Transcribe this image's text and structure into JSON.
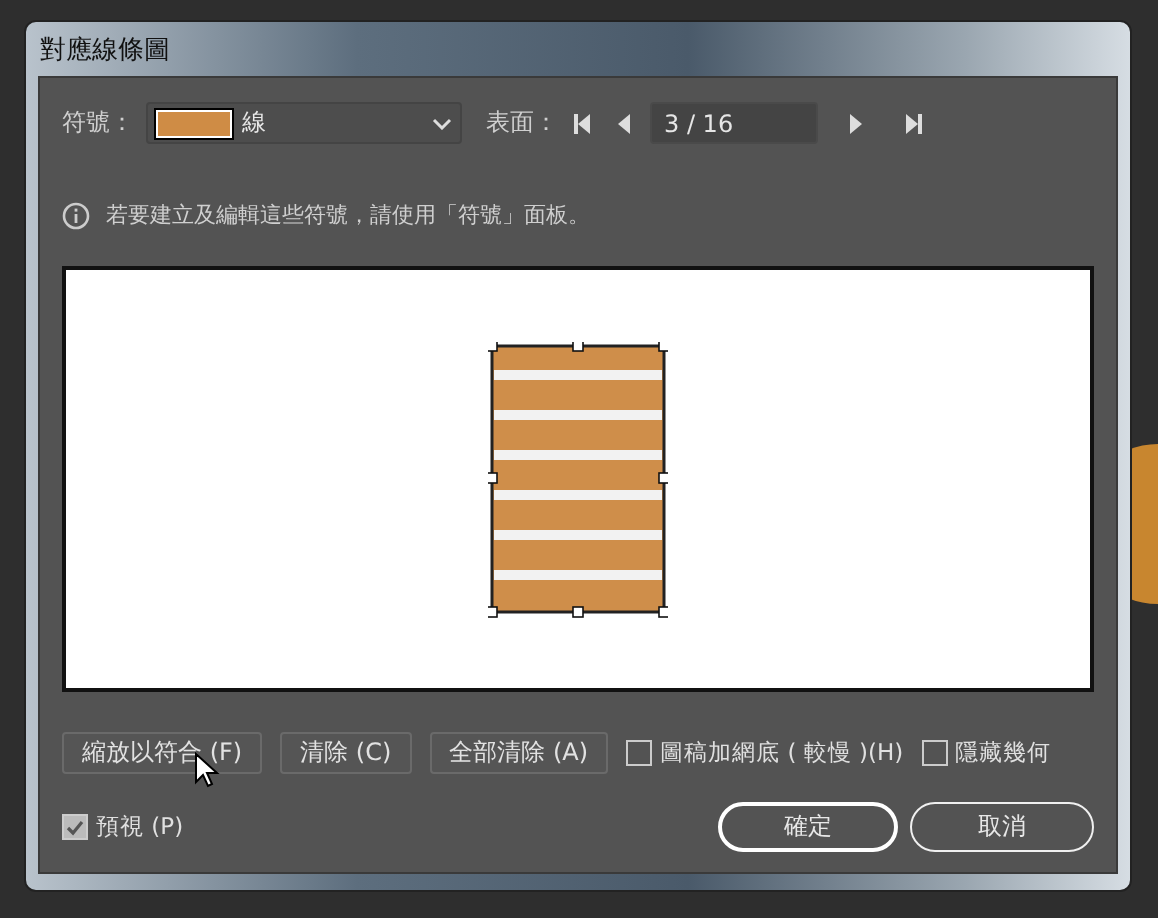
{
  "window": {
    "title": "對應線條圖"
  },
  "symbol": {
    "label": "符號：",
    "value": "線"
  },
  "surface": {
    "label": "表面：",
    "value": "3 / 16"
  },
  "info": "若要建立及編輯這些符號，請使用「符號」面板。",
  "tool_buttons": [
    "縮放以符合 (F)",
    "清除 (C)",
    "全部清除 (A)"
  ],
  "options": [
    {
      "label": "圖稿加網底 ( 較慢 )(H)",
      "checked": false
    },
    {
      "label": "隱藏幾何",
      "checked": false
    }
  ],
  "preview": {
    "label": "預視 (P)",
    "checked": true
  },
  "buttons": [
    {
      "label": "確定",
      "kind": "primary"
    },
    {
      "label": "取消",
      "kind": "secondary"
    }
  ]
}
